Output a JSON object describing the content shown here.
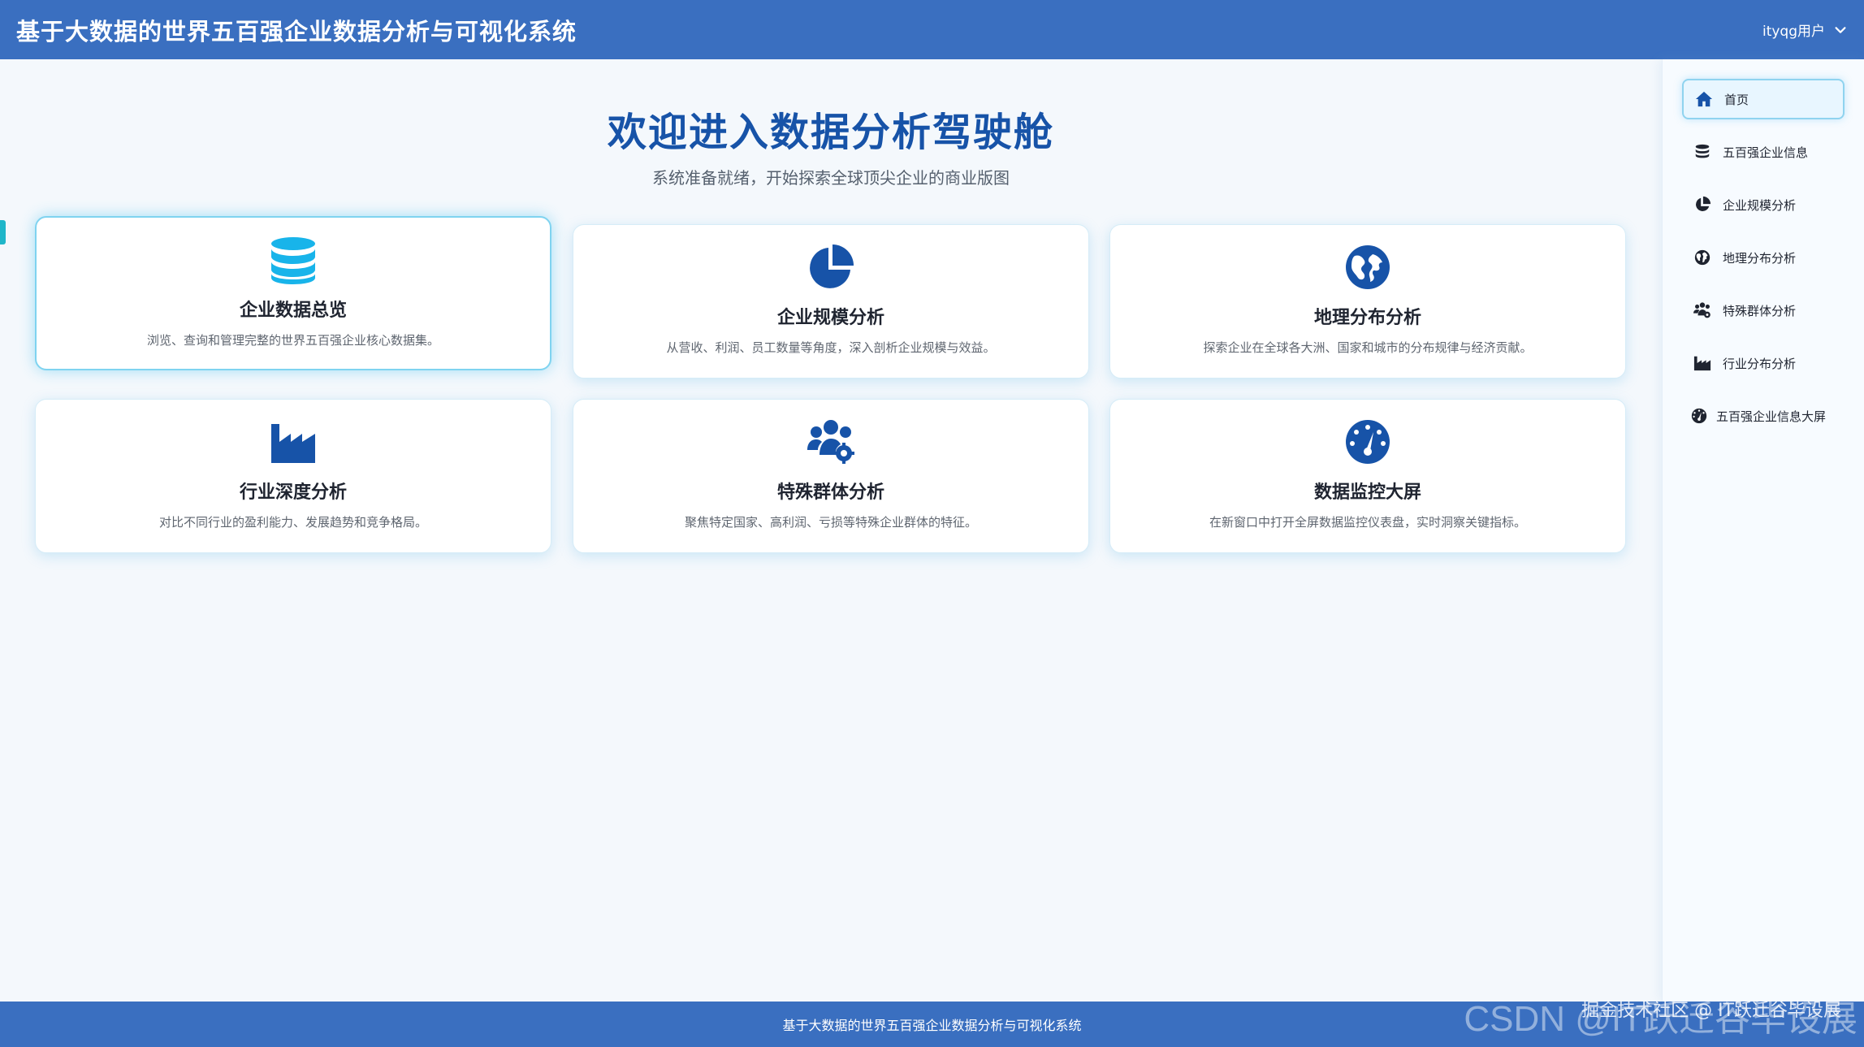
{
  "header": {
    "title": "基于大数据的世界五百强企业数据分析与可视化系统",
    "user": "ityqg用户"
  },
  "welcome": {
    "title": "欢迎进入数据分析驾驶舱",
    "subtitle": "系统准备就绪，开始探索全球顶尖企业的商业版图"
  },
  "cards": [
    {
      "title": "企业数据总览",
      "desc": "浏览、查询和管理完整的世界五百强企业核心数据集。",
      "icon": "database-icon",
      "color": "#18b4ea"
    },
    {
      "title": "企业规模分析",
      "desc": "从营收、利润、员工数量等角度，深入剖析企业规模与效益。",
      "icon": "pie-chart-icon",
      "color": "#1753a8"
    },
    {
      "title": "地理分布分析",
      "desc": "探索企业在全球各大洲、国家和城市的分布规律与经济贡献。",
      "icon": "globe-icon",
      "color": "#1753a8"
    },
    {
      "title": "行业深度分析",
      "desc": "对比不同行业的盈利能力、发展趋势和竞争格局。",
      "icon": "factory-icon",
      "color": "#1753a8"
    },
    {
      "title": "特殊群体分析",
      "desc": "聚焦特定国家、高利润、亏损等特殊企业群体的特征。",
      "icon": "users-cog-icon",
      "color": "#1753a8"
    },
    {
      "title": "数据监控大屏",
      "desc": "在新窗口中打开全屏数据监控仪表盘，实时洞察关键指标。",
      "icon": "gauge-icon",
      "color": "#1753a8"
    }
  ],
  "sidebar": {
    "items": [
      {
        "label": "首页",
        "icon": "home-icon"
      },
      {
        "label": "五百强企业信息",
        "icon": "database-icon"
      },
      {
        "label": "企业规模分析",
        "icon": "pie-chart-icon"
      },
      {
        "label": "地理分布分析",
        "icon": "globe-icon"
      },
      {
        "label": "特殊群体分析",
        "icon": "users-cog-icon"
      },
      {
        "label": "行业分布分析",
        "icon": "factory-icon"
      },
      {
        "label": "五百强企业信息大屏",
        "icon": "gauge-icon"
      }
    ]
  },
  "footer": {
    "text": "基于大数据的世界五百强企业数据分析与可视化系统"
  },
  "watermark": {
    "line1": "掘金技术社区 @ IT跃迁谷毕设展",
    "line2": "CSDN @IT跃迁谷毕设展"
  },
  "colors": {
    "header_bg": "#3a6fc0",
    "title_blue": "#1753a8",
    "accent_cyan": "#18b4ea"
  }
}
